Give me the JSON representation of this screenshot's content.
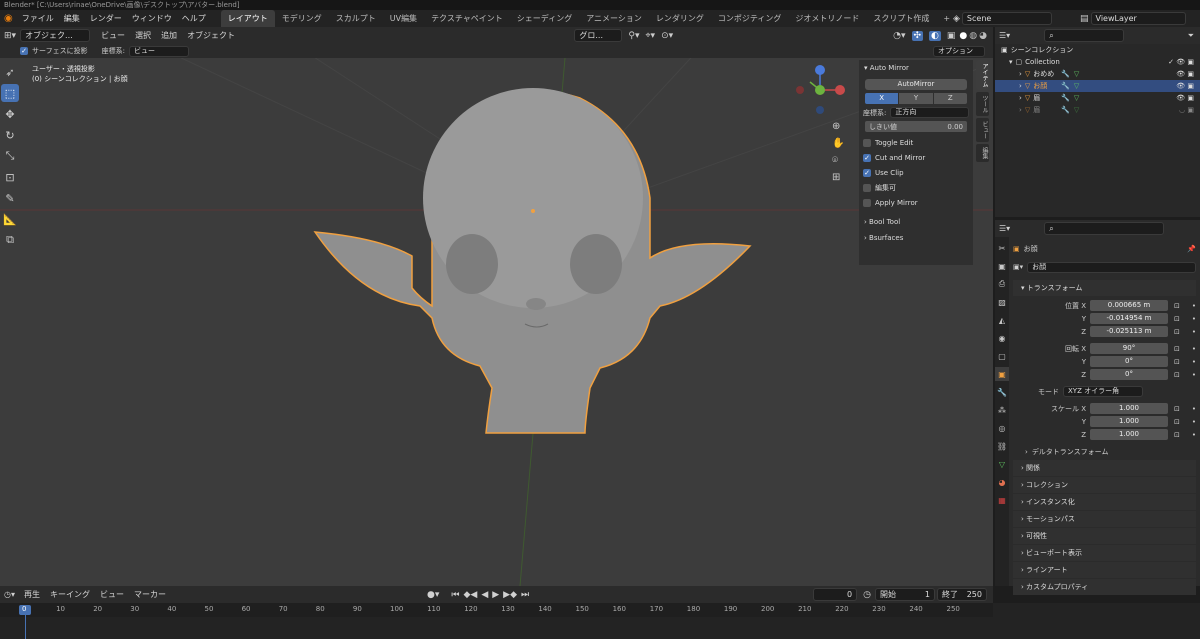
{
  "title": "Blender* [C:\\Users\\rinae\\OneDrive\\画像\\デスクトップ\\アバター.blend]",
  "menu": [
    "ファイル",
    "編集",
    "レンダー",
    "ウィンドウ",
    "ヘルプ"
  ],
  "workspaces": [
    "レイアウト",
    "モデリング",
    "スカルプト",
    "UV編集",
    "テクスチャペイント",
    "シェーディング",
    "アニメーション",
    "レンダリング",
    "コンポジティング",
    "ジオメトリノード",
    "スクリプト作成"
  ],
  "add_tab": "+",
  "scene": "Scene",
  "view_layer": "ViewLayer",
  "viewport_header": {
    "mode": "オブジェク...",
    "items": [
      "ビュー",
      "選択",
      "追加",
      "オブジェクト"
    ],
    "transform_orientation": "グロ...",
    "options": "オプション"
  },
  "viewport_header2": {
    "snap_surface": "サーフェスに投影",
    "coord_label": "座標系:",
    "coord_value": "ビュー"
  },
  "viewport_overlay": {
    "line1": "ユーザー・透視投影",
    "line2": "(0) シーンコレクション | お顔"
  },
  "npanel": {
    "title": "Auto Mirror",
    "button": "AutoMirror",
    "axes": [
      "X",
      "Y",
      "Z"
    ],
    "coord_label": "座標系:",
    "coord_value": "正方向",
    "threshold_label": "しきい値",
    "threshold_value": "0.00",
    "checks": [
      {
        "label": "Toggle Edit",
        "on": false
      },
      {
        "label": "Cut and Mirror",
        "on": true
      },
      {
        "label": "Use Clip",
        "on": true
      },
      {
        "label": "編集可",
        "on": false
      },
      {
        "label": "Apply Mirror",
        "on": false
      }
    ],
    "subpanels": [
      "Bool Tool",
      "Bsurfaces"
    ]
  },
  "vtabs": [
    "アイテム",
    "ツール",
    "ビュー",
    "編集"
  ],
  "outliner": {
    "root": "シーンコレクション",
    "collection": "Collection",
    "items": [
      "おめめ",
      "お顔",
      "眉",
      "眉"
    ]
  },
  "properties": {
    "object_name_top": "お顔",
    "object_name": "お顔",
    "transform_title": "トランスフォーム",
    "location_label": "位置 X",
    "location": [
      "0.000665 m",
      "-0.014954 m",
      "-0.025113 m"
    ],
    "rotation_label": "回転 X",
    "rotation": [
      "90°",
      "0°",
      "0°"
    ],
    "mode_label": "モード",
    "mode_value": "XYZ オイラー角",
    "scale_label": "スケール X",
    "scale": [
      "1.000",
      "1.000",
      "1.000"
    ],
    "axis_y": "Y",
    "axis_z": "Z",
    "delta": "デルタトランスフォーム",
    "sections": [
      "関係",
      "コレクション",
      "インスタンス化",
      "モーションパス",
      "可視性",
      "ビューポート表示",
      "ラインアート",
      "カスタムプロパティ"
    ]
  },
  "timeline": {
    "items": [
      "再生",
      "キーイング",
      "ビュー",
      "マーカー"
    ],
    "current_frame": "0",
    "start_label": "開始",
    "start": "1",
    "end_label": "終了",
    "end": "250",
    "ticks": [
      "0",
      "10",
      "20",
      "30",
      "40",
      "50",
      "60",
      "70",
      "80",
      "90",
      "100",
      "110",
      "120",
      "130",
      "140",
      "150",
      "160",
      "170",
      "180",
      "190",
      "200",
      "210",
      "220",
      "230",
      "240",
      "250"
    ]
  },
  "colors": {
    "accent": "#4772b3",
    "selection": "#f0a040",
    "viewport": "#3c3c3c"
  }
}
